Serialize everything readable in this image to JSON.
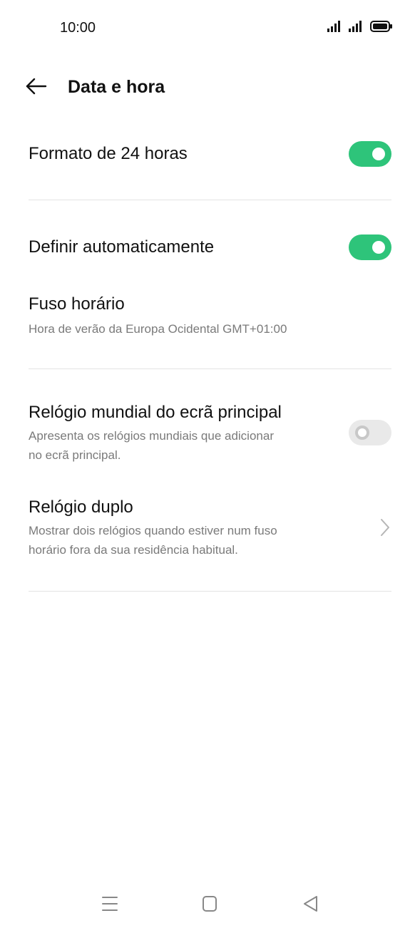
{
  "status_bar": {
    "time": "10:00"
  },
  "header": {
    "back_icon": "arrow-left-icon",
    "title": "Data e hora"
  },
  "settings": {
    "format_24h": {
      "title": "Formato de 24 horas",
      "enabled": true
    },
    "auto_set": {
      "title": "Definir automaticamente",
      "enabled": true
    },
    "timezone": {
      "title": "Fuso horário",
      "subtitle": "Hora de verão da Europa Ocidental GMT+01:00"
    },
    "world_clock": {
      "title": "Relógio mundial do ecrã principal",
      "subtitle_line1": "Apresenta os relógios mundiais que adicionar",
      "subtitle_line2": "no ecrã principal.",
      "enabled": false
    },
    "dual_clock": {
      "title": "Relógio duplo",
      "subtitle_line1": "Mostrar dois relógios quando estiver num fuso",
      "subtitle_line2": "horário fora da sua residência habitual."
    }
  },
  "colors": {
    "toggle_on": "#2ec47a",
    "toggle_off": "#e9e9e9",
    "divider": "#e3e3e3",
    "subtitle": "#7a7a7a"
  },
  "navigation": {
    "menu_icon": "menu-icon",
    "home_icon": "home-square-icon",
    "back_icon": "back-triangle-icon"
  }
}
